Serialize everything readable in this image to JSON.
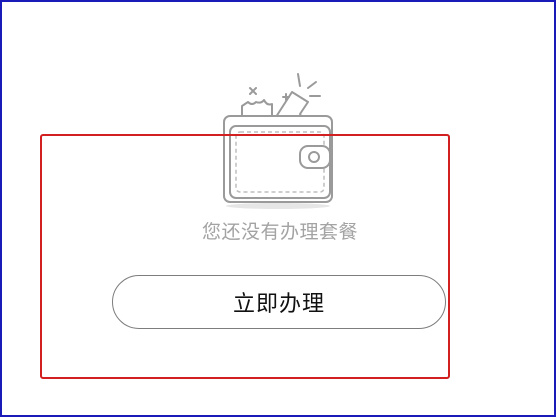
{
  "empty_state": {
    "icon": "wallet-with-ticket-icon",
    "message": "您还没有办理套餐"
  },
  "actions": {
    "apply_now_label": "立即办理"
  },
  "colors": {
    "frame_border": "#1a1ab8",
    "highlight_border": "#d21f1f",
    "message_text": "#a3a3a3",
    "button_border": "#7d7d7d",
    "illustration_stroke": "#9a9a9a"
  }
}
